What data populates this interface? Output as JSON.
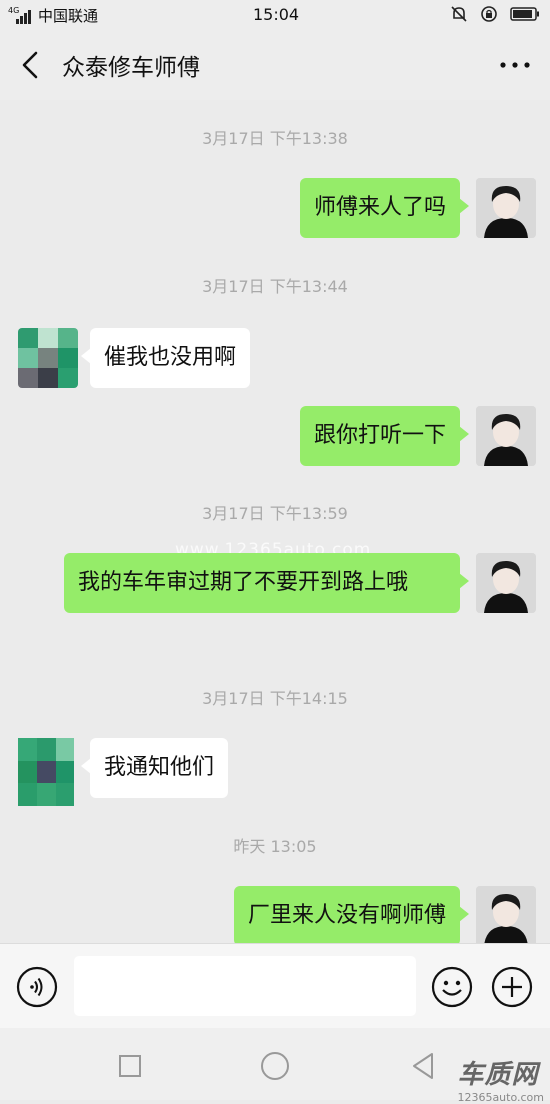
{
  "status_bar": {
    "network": "4G",
    "carrier": "中国联通",
    "time": "15:04"
  },
  "header": {
    "title": "众泰修车师傅"
  },
  "messages": [
    {
      "type": "time",
      "text": "3月17日 下午13:38"
    },
    {
      "type": "msg",
      "from": "me",
      "text": "师傅来人了吗"
    },
    {
      "type": "time",
      "text": "3月17日 下午13:44"
    },
    {
      "type": "msg",
      "from": "other",
      "text": "催我也没用啊"
    },
    {
      "type": "msg",
      "from": "me",
      "text": "跟你打听一下"
    },
    {
      "type": "time",
      "text": "3月17日 下午13:59"
    },
    {
      "type": "msg",
      "from": "me",
      "text": "我的车年审过期了不要开到路上哦"
    },
    {
      "type": "time",
      "text": "3月17日 下午14:15"
    },
    {
      "type": "msg",
      "from": "other",
      "text": "我通知他们"
    },
    {
      "type": "time",
      "text": "昨天 13:05"
    },
    {
      "type": "msg",
      "from": "me",
      "text": "厂里来人没有啊师傅"
    }
  ],
  "watermark": {
    "center": "www.12365auto.com",
    "logo": "车质网",
    "logo_url": "12365auto.com"
  },
  "input": {
    "placeholder": ""
  },
  "colors": {
    "my_bubble": "#95ec69",
    "their_bubble": "#ffffff",
    "background": "#ebebeb"
  },
  "icons": {
    "back": "chevron-left-icon",
    "more": "more-dots-icon",
    "voice": "voice-icon",
    "emoji": "emoji-icon",
    "plus": "plus-icon"
  }
}
